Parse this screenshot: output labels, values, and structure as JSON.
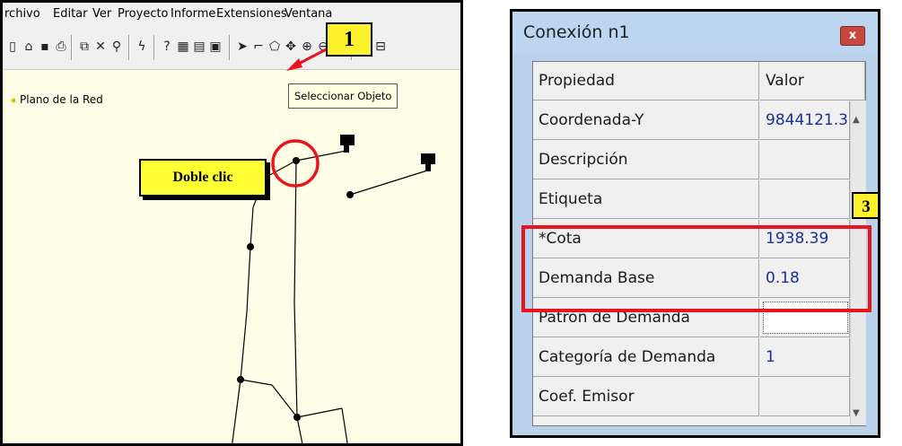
{
  "app": {
    "menu": [
      "rchivo",
      "Editar",
      "Ver",
      "Proyecto",
      "Informe",
      "Extensiones",
      "Ventana"
    ],
    "tooltip": "Seleccionar Objeto",
    "map_title": "Plano de la Red",
    "colors": {
      "map_bg": "#fffde6",
      "pipe": "#000000",
      "highlight": "#e8141e",
      "callout": "#fdf22c"
    }
  },
  "callouts": {
    "step1": "1",
    "double_click": "Doble clic",
    "step3": "3"
  },
  "dialog": {
    "title": "Conexión n1",
    "close_label": "x",
    "header": {
      "property": "Propiedad",
      "value": "Valor"
    },
    "rows": [
      {
        "property": "Coordenada-Y",
        "value": "9844121.3"
      },
      {
        "property": "Descripción",
        "value": ""
      },
      {
        "property": "Etiqueta",
        "value": ""
      },
      {
        "property": "*Cota",
        "value": "1938.39"
      },
      {
        "property": "Demanda Base",
        "value": "0.18"
      },
      {
        "property": "Patrón de Demanda",
        "value": ""
      },
      {
        "property": "Categoría de Demanda",
        "value": "1"
      },
      {
        "property": "Coef. Emisor",
        "value": ""
      }
    ]
  }
}
